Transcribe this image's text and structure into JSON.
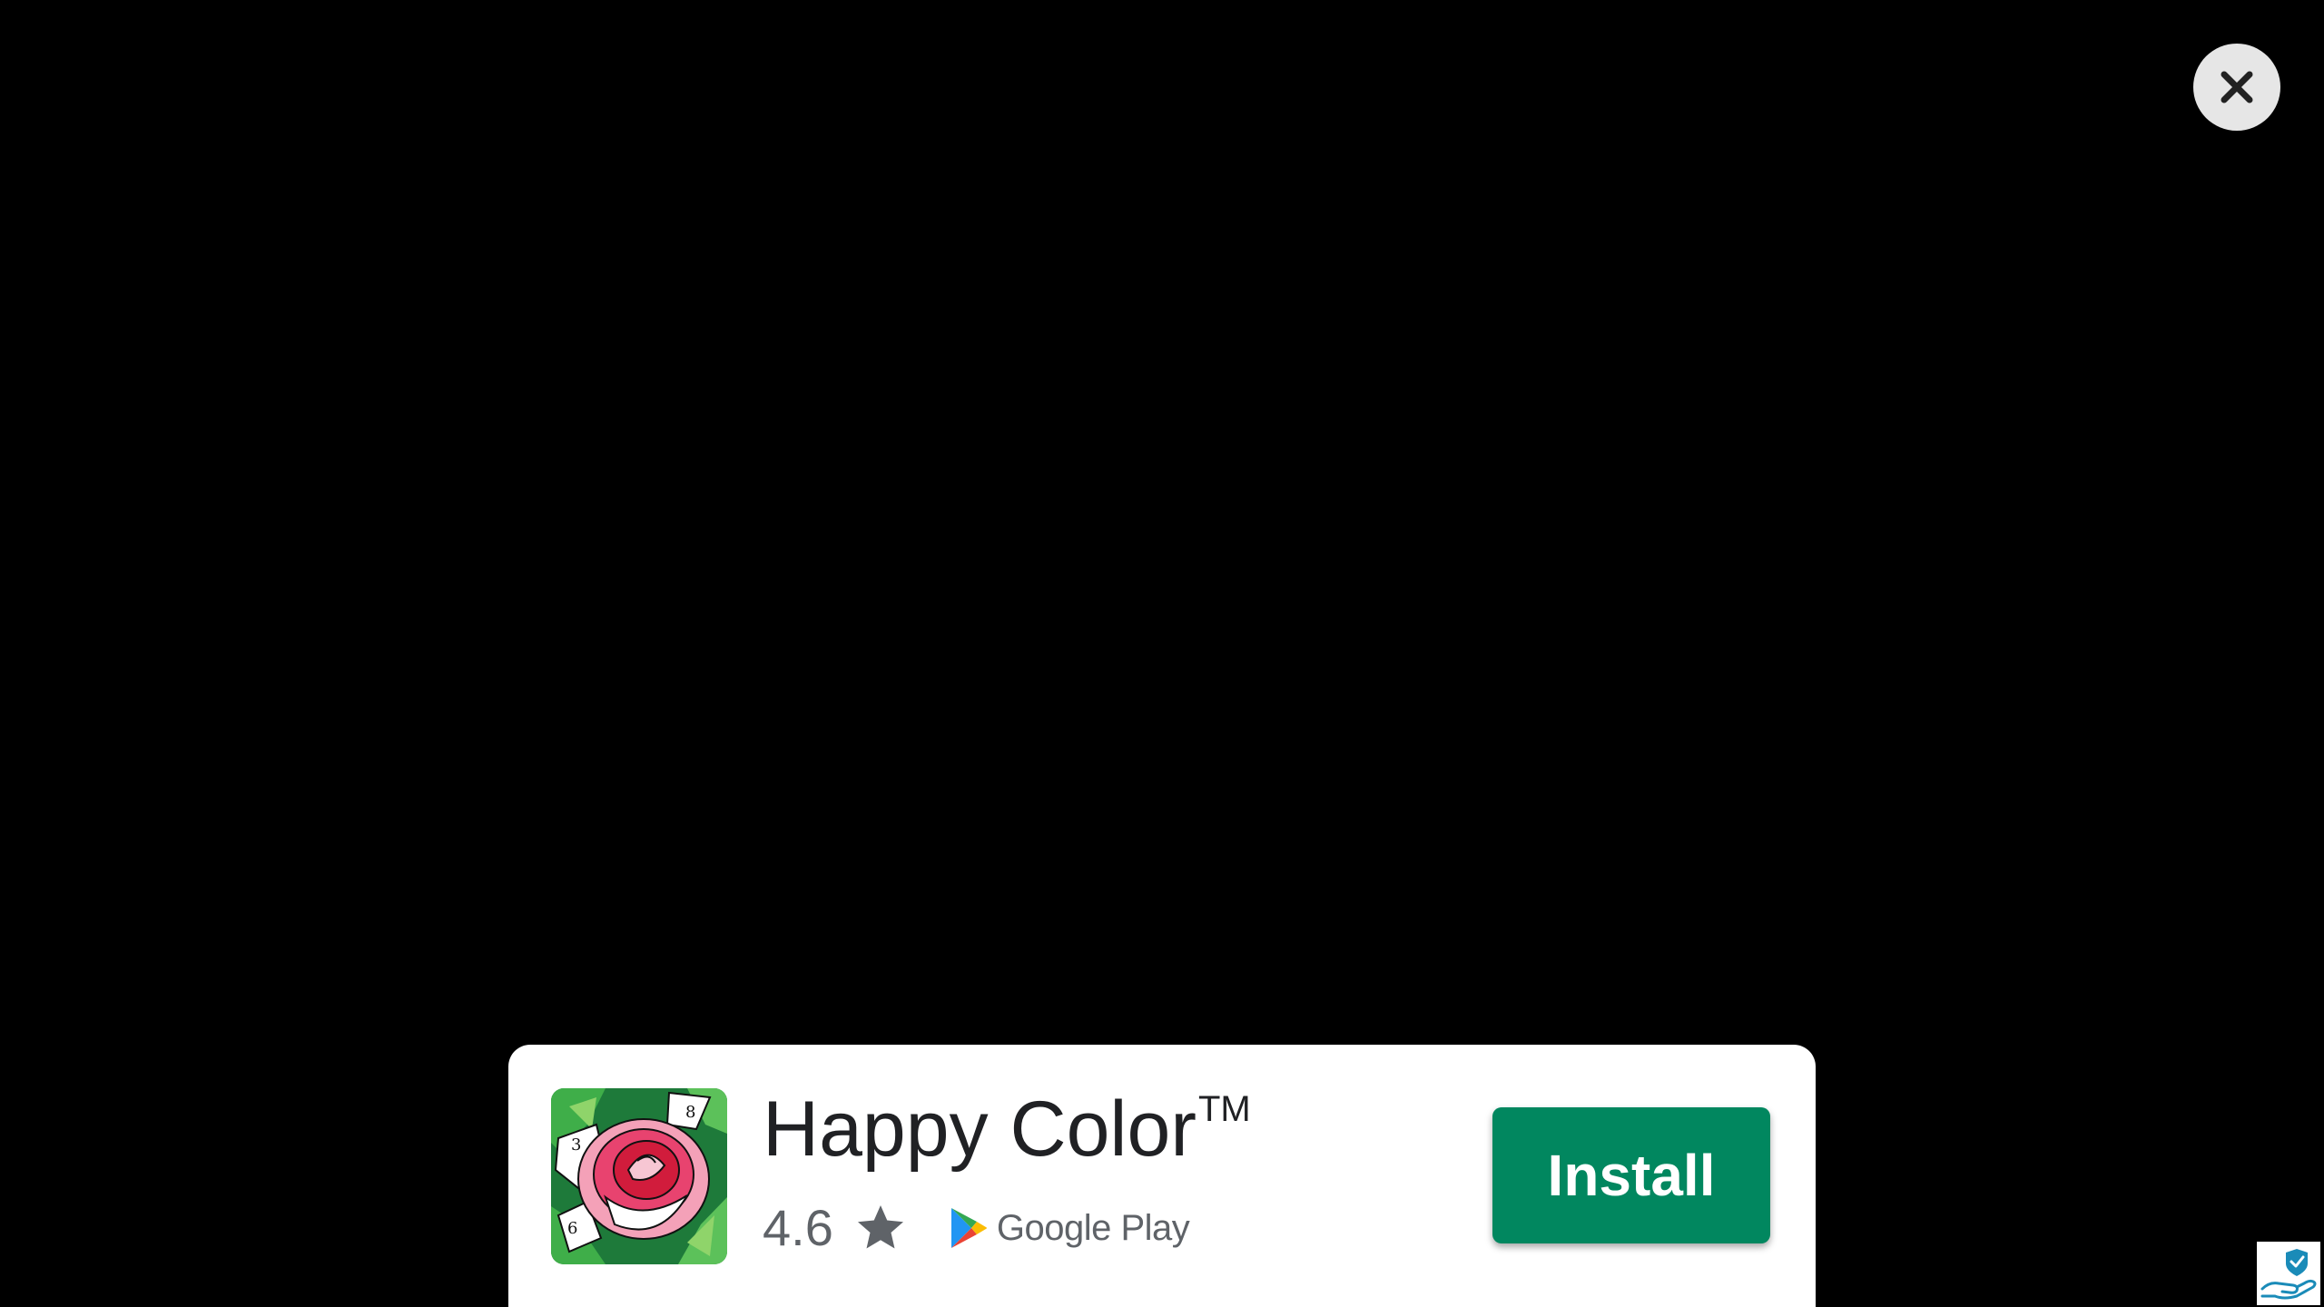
{
  "close_button": {
    "icon": "close-icon",
    "background": "#e6e6e6"
  },
  "ad": {
    "app_icon": "happy-color-rose-icon",
    "app_name": "Happy Color",
    "trademark": "TM",
    "rating": "4.6",
    "rating_icon": "star-icon",
    "store_name": "Google Play",
    "install_label": "Install",
    "accent_color": "#01875f"
  },
  "ad_badge": {
    "icon": "adchoices-icon",
    "icon_color": "#1a8bb8"
  },
  "app_icon_numbers": [
    "8",
    "3",
    "6"
  ]
}
